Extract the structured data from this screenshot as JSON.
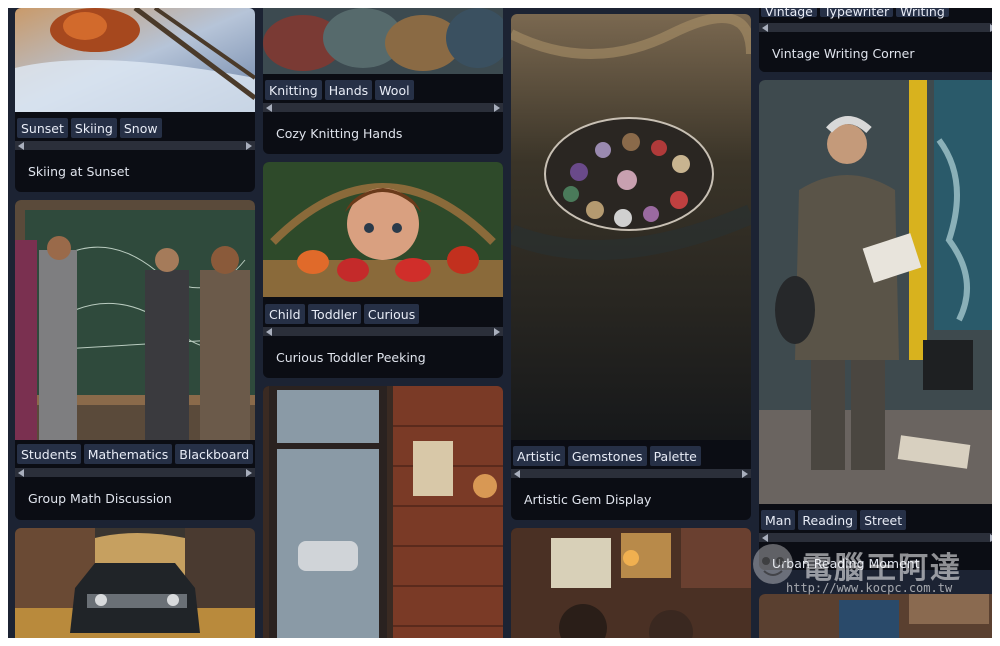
{
  "cards": [
    {
      "id": "skiing",
      "tags": [
        "Sunset",
        "Skiing",
        "Snow"
      ],
      "caption": "Skiing at Sunset"
    },
    {
      "id": "math",
      "tags": [
        "Students",
        "Mathematics",
        "Blackboard"
      ],
      "caption": "Group Math Discussion"
    },
    {
      "id": "knitting",
      "tags": [
        "Knitting",
        "Hands",
        "Wool"
      ],
      "caption": "Cozy Knitting Hands"
    },
    {
      "id": "toddler",
      "tags": [
        "Child",
        "Toddler",
        "Curious"
      ],
      "caption": "Curious Toddler Peeking"
    },
    {
      "id": "gems",
      "tags": [
        "Artistic",
        "Gemstones",
        "Palette"
      ],
      "caption": "Artistic Gem Display"
    },
    {
      "id": "vintage",
      "tags": [
        "Vintage",
        "Typewriter",
        "Writing"
      ],
      "caption": "Vintage Writing Corner"
    },
    {
      "id": "reading",
      "tags": [
        "Man",
        "Reading",
        "Street"
      ],
      "caption": "Urban Reading Moment"
    }
  ],
  "watermark": {
    "title": "電腦王阿達",
    "url": "http://www.kocpc.com.tw"
  },
  "colors": {
    "background": "#1c2333",
    "card": "#0b0d14",
    "tag": "#263046",
    "caption_text": "#dfe3ec"
  }
}
